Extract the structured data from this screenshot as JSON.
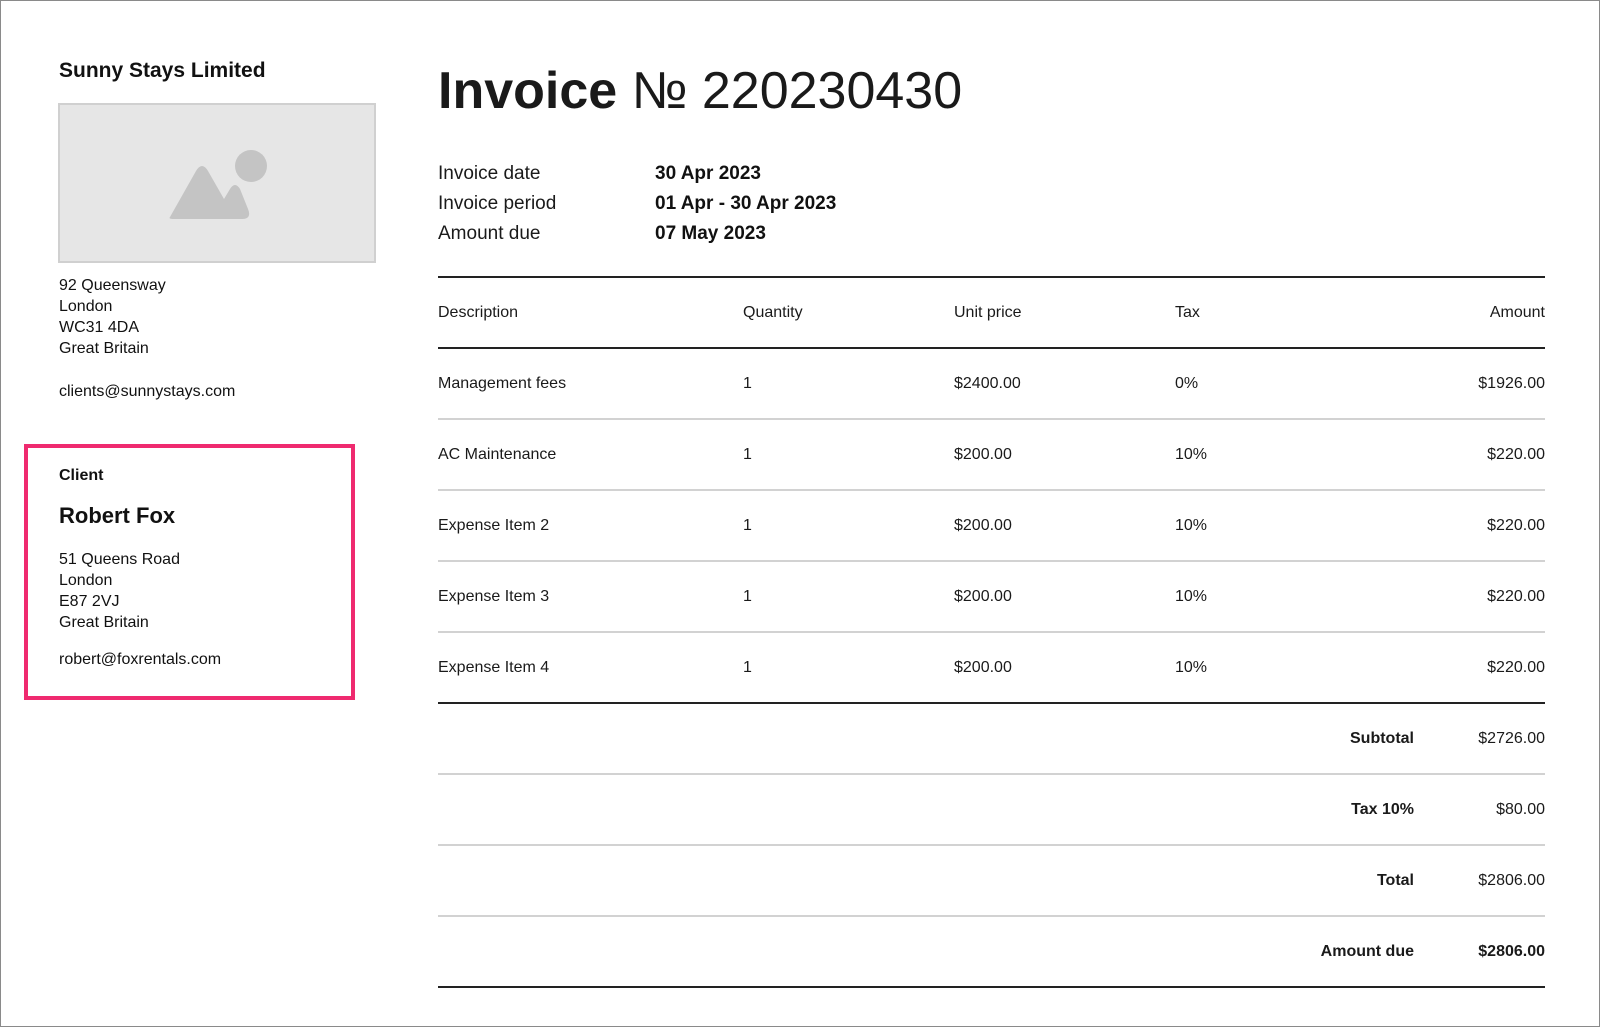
{
  "company": {
    "name": "Sunny Stays Limited",
    "logo_icon": "image-placeholder-icon",
    "address_lines": [
      "92 Queensway",
      "London",
      "WC31 4DA",
      "Great Britain"
    ],
    "email": "clients@sunnystays.com"
  },
  "client": {
    "heading": "Client",
    "name": "Robert Fox",
    "address_lines": [
      "51 Queens Road",
      "London",
      "E87 2VJ",
      "Great Britain"
    ],
    "email": "robert@foxrentals.com",
    "highlight_color": "#ef2a6f"
  },
  "invoice": {
    "title_word": "Invoice",
    "title_number": "№ 220230430",
    "meta": [
      {
        "label": "Invoice date",
        "value": "30 Apr 2023"
      },
      {
        "label": "Invoice period",
        "value": "01 Apr - 30 Apr 2023"
      },
      {
        "label": "Amount due",
        "value": "07 May 2023"
      }
    ]
  },
  "table": {
    "headers": {
      "description": "Description",
      "quantity": "Quantity",
      "unit_price": "Unit price",
      "tax": "Tax",
      "amount": "Amount"
    },
    "rows": [
      {
        "description": "Management fees",
        "quantity": "1",
        "unit_price": "$2400.00",
        "tax": "0%",
        "amount": "$1926.00"
      },
      {
        "description": "AC Maintenance",
        "quantity": "1",
        "unit_price": "$200.00",
        "tax": "10%",
        "amount": "$220.00"
      },
      {
        "description": "Expense Item 2",
        "quantity": "1",
        "unit_price": "$200.00",
        "tax": "10%",
        "amount": "$220.00"
      },
      {
        "description": "Expense Item 3",
        "quantity": "1",
        "unit_price": "$200.00",
        "tax": "10%",
        "amount": "$220.00"
      },
      {
        "description": "Expense Item 4",
        "quantity": "1",
        "unit_price": "$200.00",
        "tax": "10%",
        "amount": "$220.00"
      }
    ],
    "summary": [
      {
        "label": "Subtotal",
        "value": "$2726.00"
      },
      {
        "label": "Tax 10%",
        "value": "$80.00"
      },
      {
        "label": "Total",
        "value": "$2806.00"
      },
      {
        "label": "Amount due",
        "value": "$2806.00"
      }
    ]
  }
}
